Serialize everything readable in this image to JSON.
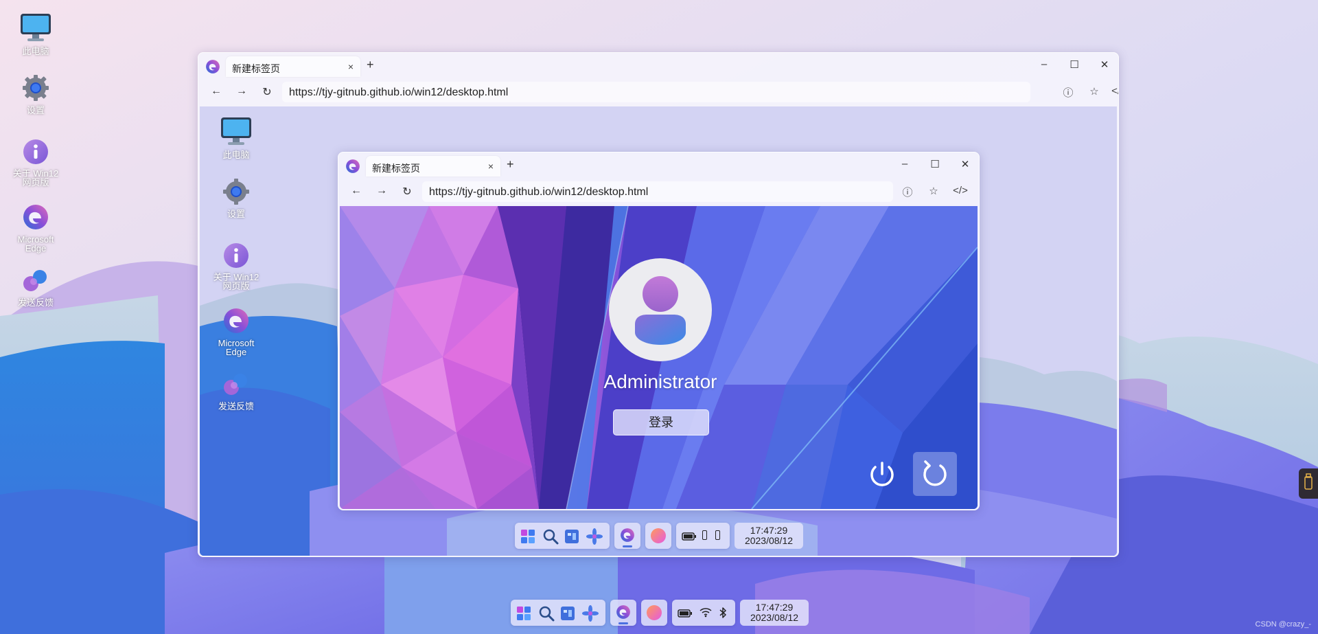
{
  "desktop": {
    "icons": [
      {
        "label": "此电脑",
        "icon": "monitor-icon"
      },
      {
        "label": "设置",
        "icon": "gear-icon"
      },
      {
        "label": "关于 Win12 网页版",
        "icon": "info-icon"
      },
      {
        "label": "Microsoft Edge",
        "icon": "edge-icon"
      },
      {
        "label": "发送反馈",
        "icon": "feedback-icon"
      }
    ]
  },
  "browser_outer": {
    "tab_title": "新建标签页",
    "tab_close": "×",
    "new_tab": "+",
    "url": "https://tjy-gitnub.github.io/win12/desktop.html",
    "window_controls": {
      "minimize": "–",
      "maximize": "☐",
      "close": "✕"
    },
    "nav": {
      "back": "←",
      "forward": "→",
      "reload": "↻"
    },
    "tools": {
      "info": "ⓘ",
      "favorite": "☆",
      "devtools": "</>"
    }
  },
  "desktop_inner": {
    "icons": [
      {
        "label": "此电脑"
      },
      {
        "label": "设置"
      },
      {
        "label": "关于 Win12 网页版"
      },
      {
        "label": "Microsoft Edge"
      },
      {
        "label": "发送反馈"
      }
    ]
  },
  "browser_inner": {
    "tab_title": "新建标签页",
    "tab_close": "×",
    "new_tab": "+",
    "url": "https://tjy-gitnub.github.io/win12/desktop.html",
    "window_controls": {
      "minimize": "–",
      "maximize": "☐",
      "close": "✕"
    },
    "nav": {
      "back": "←",
      "forward": "→",
      "reload": "↻"
    },
    "tools": {
      "info": "ⓘ",
      "favorite": "☆",
      "devtools": "</>"
    }
  },
  "login": {
    "username": "Administrator",
    "login_label": "登录"
  },
  "taskbar_inner": {
    "time": "17:47:29",
    "date": "2023/08/12"
  },
  "taskbar_main": {
    "time": "17:47:29",
    "date": "2023/08/12"
  },
  "watermark": "CSDN @crazy_-",
  "colors": {
    "accent": "#5b5ee0",
    "edge_blue": "#2a6fd6",
    "edge_purple": "#8a4fd8"
  }
}
